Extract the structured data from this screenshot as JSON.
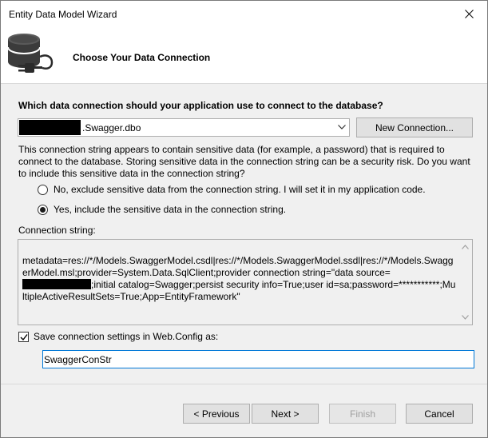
{
  "window": {
    "title": "Entity Data Model Wizard"
  },
  "header": {
    "title": "Choose Your Data Connection",
    "icon": "database-plug-icon"
  },
  "connection": {
    "question": "Which data connection should your application use to connect to the database?",
    "selected_suffix": ".Swagger.dbo",
    "new_connection_label": "New Connection..."
  },
  "sensitive": {
    "description": "This connection string appears to contain sensitive data (for example, a password) that is required to connect to the database. Storing sensitive data in the connection string can be a security risk. Do you want to include this sensitive data in the connection string?",
    "option_no": "No, exclude sensitive data from the connection string. I will set it in my application code.",
    "option_yes": "Yes, include the sensitive data in the connection string.",
    "selected": "yes"
  },
  "connection_string": {
    "label": "Connection string:",
    "part1": "metadata=res://*/Models.SwaggerModel.csdl|res://*/Models.SwaggerModel.ssdl|res://*/Models.SwaggerModel.msl;provider=System.Data.SqlClient;provider connection string=\"data source=",
    "part2": ";initial catalog=Swagger;persist security info=True;user id=sa;password=***********;MultipleActiveResultSets=True;App=EntityFramework\""
  },
  "save": {
    "label": "Save connection settings in Web.Config as:",
    "checked": true,
    "name_value": "SwaggerConStr"
  },
  "buttons": {
    "previous": "< Previous",
    "next": "Next >",
    "finish": "Finish",
    "cancel": "Cancel"
  }
}
